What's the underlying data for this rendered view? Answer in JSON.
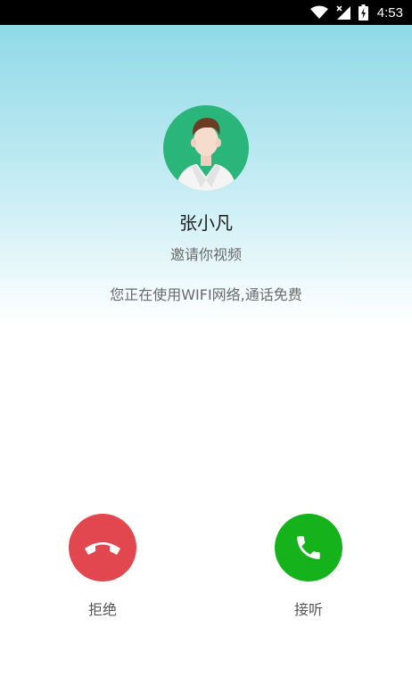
{
  "status_bar": {
    "time": "4:53",
    "icons": [
      "wifi-icon",
      "signal-off-icon",
      "battery-charging-icon"
    ]
  },
  "caller": {
    "name": "张小凡",
    "call_type": "邀请你视频",
    "network_note": "您正在使用WIFI网络,通话免费"
  },
  "actions": {
    "decline_label": "拒绝",
    "answer_label": "接听"
  },
  "colors": {
    "decline": "#e2474f",
    "answer": "#15b21c",
    "avatar_bg": "#2ab57a",
    "hero_top": "#8fd9e7"
  }
}
